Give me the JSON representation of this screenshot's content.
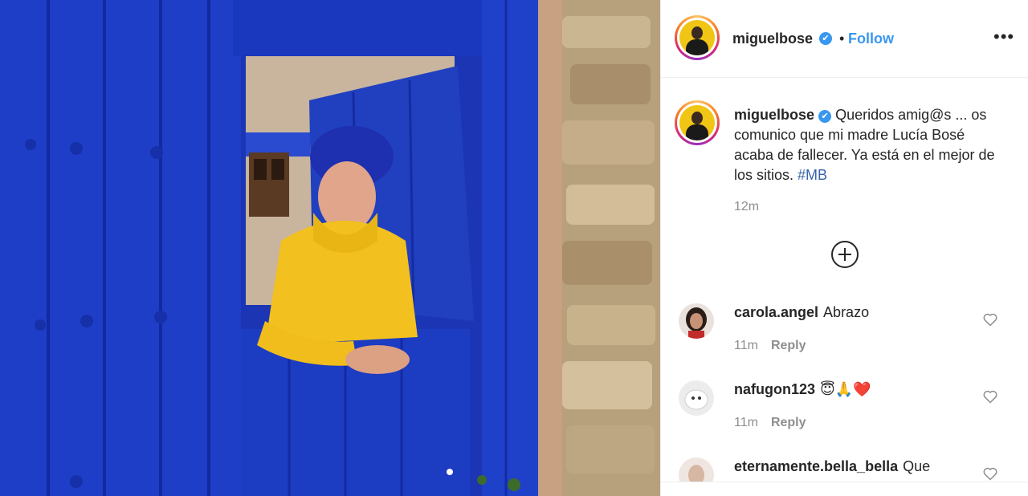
{
  "post": {
    "author": "miguelbose",
    "follow_label": "Follow",
    "separator": "•",
    "more_label": "•••",
    "verified_mark": "✔",
    "caption": {
      "username": "miguelbose",
      "text": "Queridos amig@s ... os comunico que mi madre Lucía Bosé acaba de fallecer. Ya está en el mejor de los sitios.",
      "hashtag": "#MB",
      "time": "12m"
    },
    "load_more_icon": "plus-circle-icon"
  },
  "comments": [
    {
      "username": "carola.angel",
      "text": "Abrazo",
      "time": "11m",
      "reply_label": "Reply"
    },
    {
      "username": "nafugon123",
      "text": "😇🙏❤️",
      "time": "11m",
      "reply_label": "Reply"
    },
    {
      "username": "eternamente.bella_bella",
      "text": "Que",
      "time": "",
      "reply_label": ""
    }
  ],
  "colors": {
    "link_blue": "#3897f0",
    "door_blue": "#1f3fc4",
    "sweater_yellow": "#f2c01f",
    "muted": "#8e8e8e"
  }
}
